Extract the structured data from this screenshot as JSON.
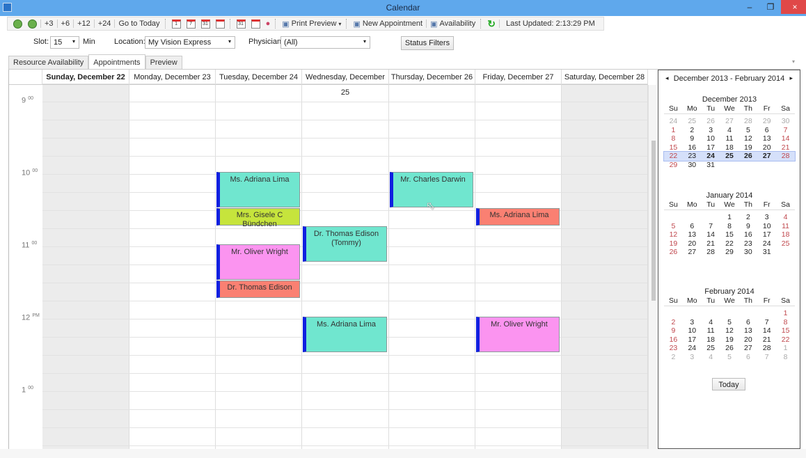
{
  "window": {
    "title": "Calendar",
    "minimize": "–",
    "restore": "❐",
    "close": "×"
  },
  "toolbar": {
    "items": [
      "+3",
      "+6",
      "+12",
      "+24",
      "Go to Today"
    ],
    "print_preview": "Print Preview",
    "new_appointment": "New Appointment",
    "availability": "Availability",
    "last_updated": "Last Updated: 2:13:29 PM"
  },
  "filters": {
    "slot_label": "Slot:",
    "slot_value": "15",
    "min_label": "Min",
    "location_label": "Location:",
    "location_value": "My Vision Express",
    "physician_label": "Physician:",
    "physician_value": "(All)",
    "status_filters": "Status Filters"
  },
  "tabs": [
    {
      "label": "Resource Availability"
    },
    {
      "label": "Appointments",
      "active": true
    },
    {
      "label": "Preview"
    }
  ],
  "days": [
    "Sunday, December 22",
    "Monday, December 23",
    "Tuesday, December 24",
    "Wednesday, December 25",
    "Thursday, December 26",
    "Friday, December 27",
    "Saturday, December 28"
  ],
  "time_labels": [
    {
      "h": "9",
      "s": "00"
    },
    {
      "h": "10",
      "s": "00"
    },
    {
      "h": "11",
      "s": "00"
    },
    {
      "h": "12",
      "s": "PM"
    },
    {
      "h": "1",
      "s": "00"
    }
  ],
  "slot_minutes": 15,
  "colors": {
    "aqua": "#70e6cf",
    "lime": "#c6e43c",
    "pink": "#fb94f0",
    "salmon": "#fa8072",
    "marker": "#1020e0"
  },
  "appointments": [
    {
      "day": 2,
      "start": "10:00",
      "end": "10:30",
      "name": "Ms. Adriana Lima",
      "color": "aqua"
    },
    {
      "day": 2,
      "start": "10:30",
      "end": "10:45",
      "name": "Mrs. Gisele C Bündchen",
      "color": "lime"
    },
    {
      "day": 2,
      "start": "11:00",
      "end": "11:30",
      "name": "Mr. Oliver Wright",
      "color": "pink"
    },
    {
      "day": 2,
      "start": "11:30",
      "end": "11:45",
      "name": "Dr. Thomas Edison",
      "color": "salmon"
    },
    {
      "day": 3,
      "start": "10:45",
      "end": "11:15",
      "name": "Dr. Thomas Edison (Tommy)",
      "color": "aqua"
    },
    {
      "day": 3,
      "start": "12:00",
      "end": "12:30",
      "name": "Ms. Adriana Lima",
      "color": "aqua"
    },
    {
      "day": 4,
      "start": "10:00",
      "end": "10:30",
      "name": "Mr. Charles Darwin",
      "color": "aqua"
    },
    {
      "day": 5,
      "start": "10:30",
      "end": "10:45",
      "name": "Ms. Adriana Lima",
      "color": "salmon"
    },
    {
      "day": 5,
      "start": "12:00",
      "end": "12:30",
      "name": "Mr. Oliver Wright",
      "color": "pink"
    }
  ],
  "sidebar": {
    "range": "December 2013 - February 2014",
    "prev": "◂",
    "next": "▸",
    "today": "Today",
    "weekdays": [
      "Su",
      "Mo",
      "Tu",
      "We",
      "Th",
      "Fr",
      "Sa"
    ],
    "months": [
      {
        "title": "December 2013",
        "weeks": [
          [
            "24",
            "25",
            "26",
            "27",
            "28",
            "29",
            "30"
          ],
          [
            "1",
            "2",
            "3",
            "4",
            "5",
            "6",
            "7"
          ],
          [
            "8",
            "9",
            "10",
            "11",
            "12",
            "13",
            "14"
          ],
          [
            "15",
            "16",
            "17",
            "18",
            "19",
            "20",
            "21"
          ],
          [
            "22",
            "23",
            "24",
            "25",
            "26",
            "27",
            "28"
          ],
          [
            "29",
            "30",
            "31",
            "",
            "",
            "",
            ""
          ]
        ],
        "other_month_rows": [
          0
        ],
        "selected_week": 4,
        "bold_days": [
          "24",
          "25",
          "26",
          "27"
        ]
      },
      {
        "title": "January 2014",
        "weeks": [
          [
            "",
            "",
            "",
            "1",
            "2",
            "3",
            "4"
          ],
          [
            "5",
            "6",
            "7",
            "8",
            "9",
            "10",
            "11"
          ],
          [
            "12",
            "13",
            "14",
            "15",
            "16",
            "17",
            "18"
          ],
          [
            "19",
            "20",
            "21",
            "22",
            "23",
            "24",
            "25"
          ],
          [
            "26",
            "27",
            "28",
            "29",
            "30",
            "31",
            ""
          ]
        ]
      },
      {
        "title": "February 2014",
        "weeks": [
          [
            "",
            "",
            "",
            "",
            "",
            "",
            "1"
          ],
          [
            "2",
            "3",
            "4",
            "5",
            "6",
            "7",
            "8"
          ],
          [
            "9",
            "10",
            "11",
            "12",
            "13",
            "14",
            "15"
          ],
          [
            "16",
            "17",
            "18",
            "19",
            "20",
            "21",
            "22"
          ],
          [
            "23",
            "24",
            "25",
            "26",
            "27",
            "28",
            "1"
          ],
          [
            "2",
            "3",
            "4",
            "5",
            "6",
            "7",
            "8"
          ]
        ],
        "trailing_other_from": [
          4,
          6
        ]
      }
    ]
  }
}
